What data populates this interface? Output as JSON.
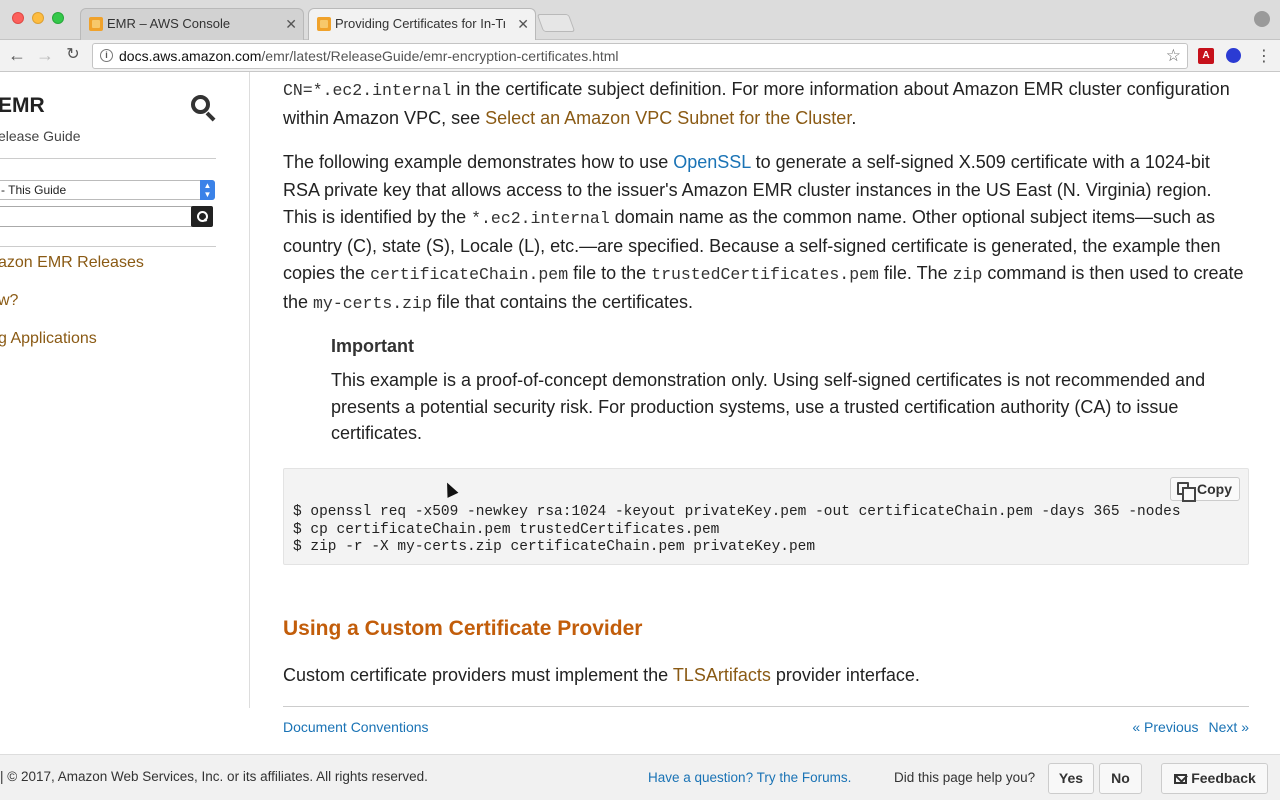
{
  "browser": {
    "tabs": [
      {
        "title": "EMR – AWS Console",
        "active": false
      },
      {
        "title": "Providing Certificates for In-Transit Encryption",
        "active": true
      }
    ],
    "url_host": "docs.aws.amazon.com",
    "url_path": "/emr/latest/ReleaseGuide/emr-encryption-certificates.html",
    "extensions": {
      "pdf": "A"
    }
  },
  "sidebar": {
    "title": "EMR",
    "subtitle": "elease Guide",
    "scope_select": "- This Guide",
    "search_input_value": "",
    "links": [
      {
        "label": "azon EMR Releases"
      },
      {
        "label": "w?"
      },
      {
        "label": "g Applications"
      }
    ]
  },
  "content": {
    "p1": {
      "code1": "CN=*.ec2.internal",
      "text1": " in the certificate subject definition. For more information about Amazon EMR cluster configuration within Amazon VPC, see ",
      "link": "Select an Amazon VPC Subnet for the Cluster",
      "text2": "."
    },
    "p2": {
      "text1": "The following example demonstrates how to use ",
      "link": "OpenSSL",
      "text2": " to generate a self-signed X.509 certificate with a 1024-bit RSA private key that allows access to the issuer's Amazon EMR cluster instances in the US East (N. Virginia) region. This is identified by the ",
      "code1": "*.ec2.internal",
      "text3": " domain name as the common name. Other optional subject items—such as country (C), state (S), Locale (L), etc.—are specified. Because a self-signed certificate is generated, the example then copies the ",
      "code2": "certificateChain.pem",
      "text4": " file to the ",
      "code3": "trustedCertificates.pem",
      "text5": " file. The ",
      "code4": "zip",
      "text6": " command is then used to create the ",
      "code5": "my-certs.zip",
      "text7": " file that contains the certificates."
    },
    "important": {
      "title": "Important",
      "body": "This example is a proof-of-concept demonstration only. Using self-signed certificates is not recommended and presents a potential security risk. For production systems, use a trusted certification authority (CA) to issue certificates."
    },
    "code_block": {
      "copy_label": "Copy",
      "lines": [
        "$ openssl req -x509 -newkey rsa:1024 -keyout privateKey.pem -out certificateChain.pem -days 365 -nodes",
        "$ cp certificateChain.pem trustedCertificates.pem",
        "$ zip -r -X my-certs.zip certificateChain.pem privateKey.pem"
      ]
    },
    "heading": "Using a Custom Certificate Provider",
    "p3": {
      "text1": "Custom certificate providers must implement the ",
      "link": "TLSArtifacts",
      "text2": " provider interface."
    },
    "doc_conventions": "Document Conventions",
    "prev": "« Previous",
    "next": "Next »"
  },
  "footer": {
    "copyright": "| © 2017, Amazon Web Services, Inc. or its affiliates. All rights reserved.",
    "forums_link": "Have a question? Try the Forums.",
    "helped_question": "Did this page help you?",
    "yes": "Yes",
    "no": "No",
    "feedback": "Feedback"
  }
}
